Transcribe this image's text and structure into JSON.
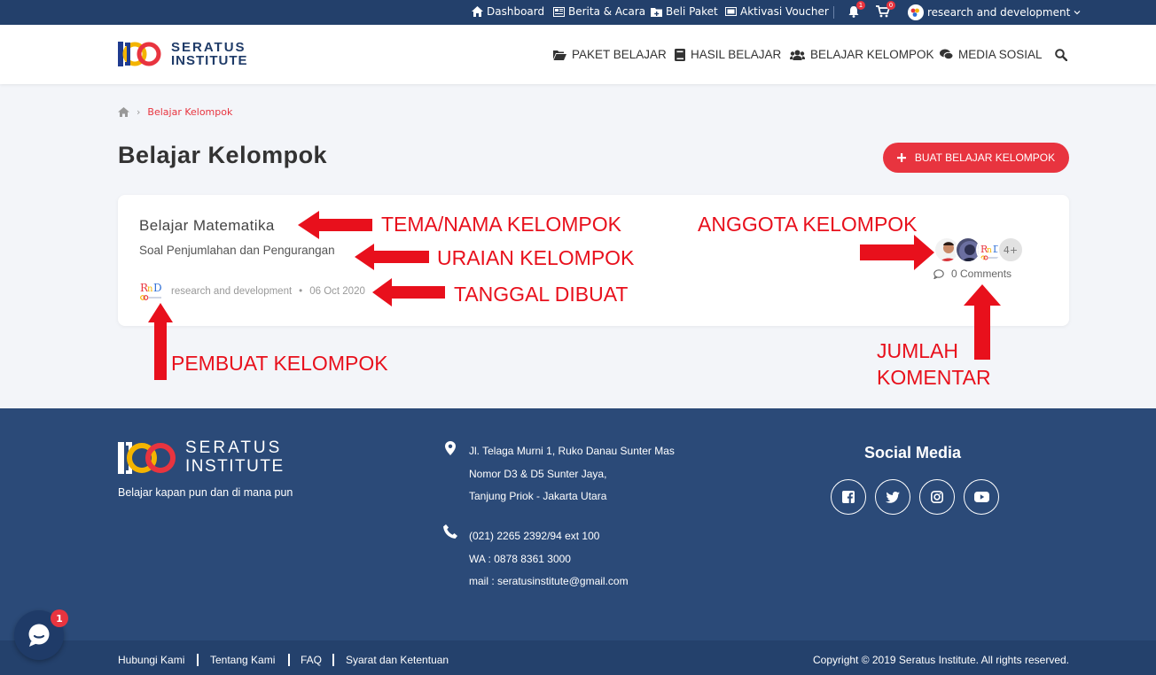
{
  "topbar": {
    "dashboard": "Dashboard",
    "news": "Berita & Acara",
    "buy": "Beli Paket",
    "voucher": "Aktivasi Voucher",
    "notif_count": "1",
    "cart_count": "0",
    "user_name": "research and development"
  },
  "header": {
    "logo_line1": "SERATUS",
    "logo_line2": "INSTITUTE",
    "nav": {
      "paket": "PAKET BELAJAR",
      "hasil": "HASIL BELAJAR",
      "kelompok": "BELAJAR KELOMPOK",
      "media": "MEDIA SOSIAL"
    }
  },
  "breadcrumb": {
    "sep": "›",
    "current": "Belajar Kelompok"
  },
  "page": {
    "title": "Belajar Kelompok",
    "create_button": "BUAT BELAJAR KELOMPOK"
  },
  "card": {
    "name": "Belajar Matematika",
    "description": "Soal Penjumlahan dan Pengurangan",
    "creator": "research and development",
    "dot": "•",
    "date": "06 Oct 2020",
    "members_more": "4+",
    "comments": "0 Comments"
  },
  "annotations": {
    "tema": "TEMA/NAMA KELOMPOK",
    "uraian": "URAIAN KELOMPOK",
    "tanggal": "TANGGAL DIBUAT",
    "pembuat": "PEMBUAT KELOMPOK",
    "anggota": "ANGGOTA KELOMPOK",
    "jumlah_1": "JUMLAH",
    "jumlah_2": "KOMENTAR"
  },
  "footer": {
    "logo_line1": "SERATUS",
    "logo_line2": "INSTITUTE",
    "tagline": "Belajar kapan pun dan di mana pun",
    "address": [
      "Jl. Telaga Murni 1, Ruko Danau Sunter Mas",
      "Nomor D3 & D5 Sunter Jaya,",
      "Tanjung Priok - Jakarta Utara"
    ],
    "contact": [
      "(021) 2265 2392/94 ext 100",
      "WA : 0878 8361 3000",
      "mail : seratusinstitute@gmail.com"
    ],
    "social_title": "Social Media"
  },
  "bottombar": {
    "links": [
      "Hubungi Kami",
      "Tentang Kami",
      "FAQ",
      "Syarat dan Ketentuan"
    ],
    "copyright": "Copyright © 2019 Seratus Institute. All rights reserved."
  },
  "chat": {
    "badge": "1"
  },
  "colors": {
    "primary": "#23406b",
    "accent": "#e8343f",
    "annotation": "#e8101c"
  }
}
